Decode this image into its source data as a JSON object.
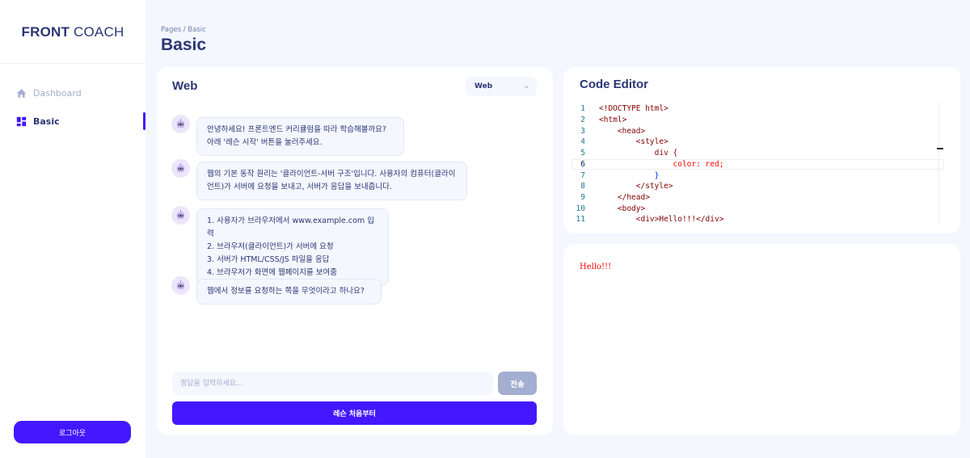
{
  "sidebar": {
    "brand_bold": "FRONT",
    "brand_light": "COACH",
    "items": [
      {
        "label": "Dashboard",
        "icon": "home-icon",
        "active": false
      },
      {
        "label": "Basic",
        "icon": "grid-icon",
        "active": true
      }
    ],
    "logout_label": "로그아웃"
  },
  "header": {
    "breadcrumb": "Pages / Basic",
    "title": "Basic"
  },
  "web_panel": {
    "title": "Web",
    "select_value": "Web",
    "messages": [
      {
        "text": "안녕하세요! 프론트엔드 커리큘럼을 따라 학습해볼까요?\n아래 '레슨 시작' 버튼을 눌러주세요."
      },
      {
        "text": "웹의 기본 동작 원리는 '클라이언트-서버 구조'입니다. 사용자의 컴퓨터(클라이언트)가 서버에 요청을 보내고, 서버가 응답을 보내줍니다."
      },
      {
        "text": "1. 사용자가 브라우저에서 www.example.com 입력\n2. 브라우저(클라이언트)가 서버에 요청\n3. 서버가 HTML/CSS/JS 파일을 응답\n4. 브라우저가 화면에 웹페이지를 보여줌"
      },
      {
        "text": "웹에서 정보를 요청하는 쪽을 무엇이라고 하나요?"
      }
    ],
    "answer_placeholder": "정답을 입력하세요...",
    "send_label": "전송",
    "restart_label": "레슨 처음부터"
  },
  "code_editor": {
    "title": "Code Editor",
    "current_line": 6,
    "lines": [
      {
        "n": "1",
        "text": "<!DOCTYPE html>"
      },
      {
        "n": "2",
        "text": "<html>"
      },
      {
        "n": "3",
        "text": "    <head>"
      },
      {
        "n": "4",
        "text": "        <style>"
      },
      {
        "n": "5",
        "text": "            div {"
      },
      {
        "n": "6",
        "text": "                color: red;"
      },
      {
        "n": "7",
        "text": "            }"
      },
      {
        "n": "8",
        "text": "        </style>"
      },
      {
        "n": "9",
        "text": "    </head>"
      },
      {
        "n": "10",
        "text": "    <body>"
      },
      {
        "n": "11",
        "text": "        <div>Hello!!!</div>"
      }
    ]
  },
  "preview": {
    "text": "Hello!!!"
  },
  "colors": {
    "accent": "#4318ff",
    "navy": "#2b3674",
    "muted": "#a3aed0",
    "background": "#f4f7fe",
    "preview_red": "#ff0000"
  }
}
